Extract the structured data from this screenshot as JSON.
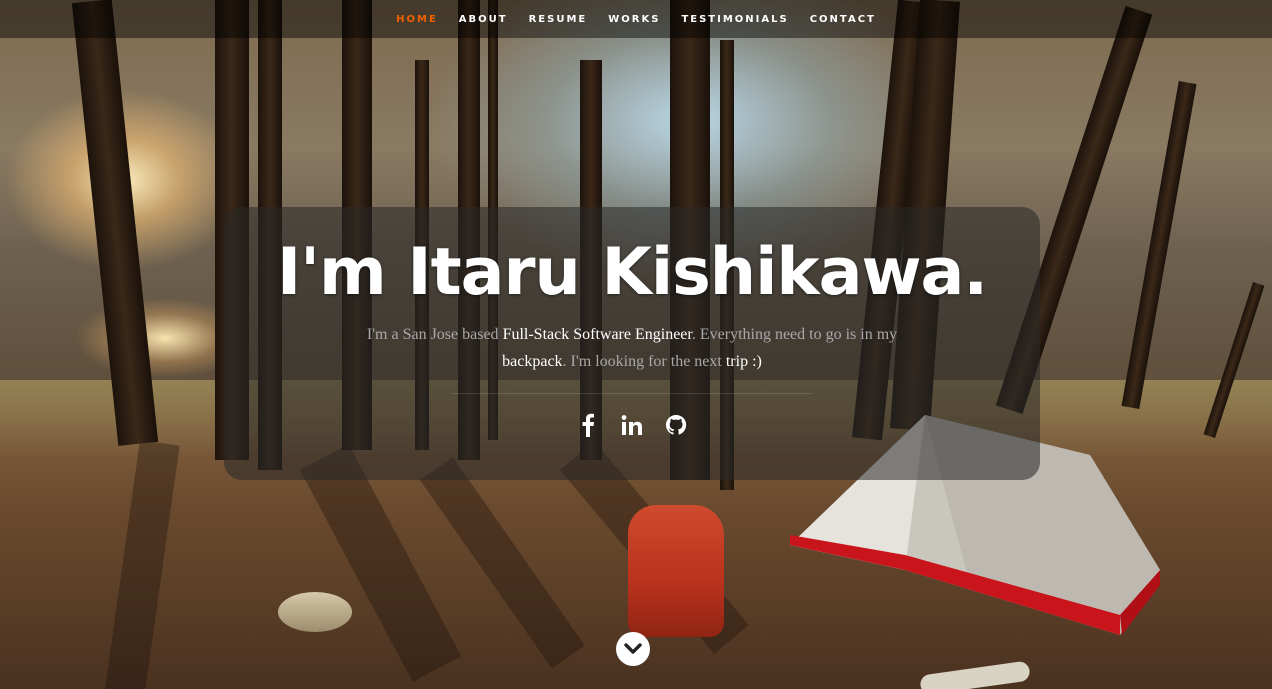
{
  "nav": {
    "items": [
      {
        "label": "HOME",
        "active": true
      },
      {
        "label": "ABOUT",
        "active": false
      },
      {
        "label": "RESUME",
        "active": false
      },
      {
        "label": "WORKS",
        "active": false
      },
      {
        "label": "TESTIMONIALS",
        "active": false
      },
      {
        "label": "CONTACT",
        "active": false
      }
    ],
    "active_color": "#f06000"
  },
  "hero": {
    "headline": "I'm Itaru Kishikawa.",
    "intro_parts": [
      {
        "text": "I'm a San Jose based ",
        "highlight": false
      },
      {
        "text": "Full-Stack Software Engineer",
        "highlight": true
      },
      {
        "text": ". Everything need to go is in my ",
        "highlight": false
      },
      {
        "text": "backpack",
        "highlight": true
      },
      {
        "text": ". I'm looking for the next ",
        "highlight": false
      },
      {
        "text": "trip :)",
        "highlight": true
      }
    ]
  },
  "social": [
    {
      "icon": "facebook-icon"
    },
    {
      "icon": "linkedin-icon"
    },
    {
      "icon": "github-icon"
    }
  ],
  "scroll_icon": "chevron-down-icon"
}
